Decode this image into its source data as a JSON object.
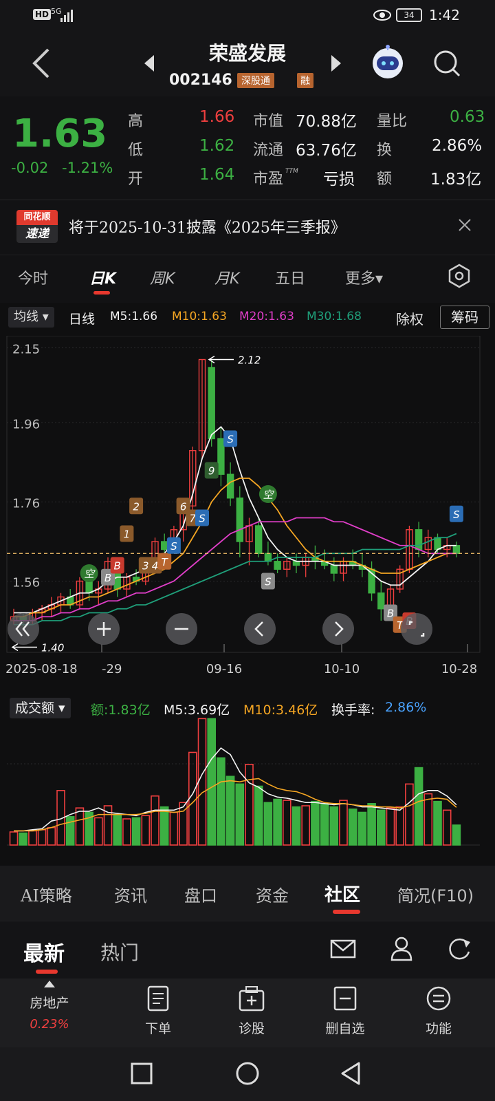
{
  "status": {
    "hd": "HD",
    "net": "5G",
    "battery": "34",
    "time": "1:42"
  },
  "header": {
    "name": "荣盛发展",
    "code": "002146",
    "tag1": "深股通",
    "tag2": "融"
  },
  "quote": {
    "price": "1.63",
    "change": "-0.02",
    "pct": "-1.21%",
    "high_label": "高",
    "high": "1.66",
    "low_label": "低",
    "low": "1.62",
    "open_label": "开",
    "open": "1.64",
    "mcap_label": "市值",
    "mcap": "70.88亿",
    "float_label": "流通",
    "float": "63.76亿",
    "pe_label": "市盈",
    "pe_sup": "TTM",
    "pe": "亏损",
    "vr_label": "量比",
    "vr": "0.63",
    "turn_label": "换",
    "turn": "2.86%",
    "amt_label": "额",
    "amt": "1.83亿"
  },
  "notice": {
    "badge_top": "同花顺",
    "badge_bottom": "速递",
    "text": "将于2025-10-31披露《2025年三季报》"
  },
  "ktabs": [
    "今时",
    "日K",
    "周K",
    "月K",
    "五日",
    "更多▾"
  ],
  "ma_legend": {
    "btn": "均线",
    "period": "日线",
    "m5": "M5:1.66",
    "m10": "M10:1.63",
    "m20": "M20:1.63",
    "m30": "M30:1.68",
    "exright": "除权",
    "chip": "筹码"
  },
  "chart_data": {
    "type": "candlestick",
    "yticks": [
      "2.15",
      "1.96",
      "1.76",
      "1.56"
    ],
    "ylim": [
      1.38,
      2.18
    ],
    "dates": [
      "2025-08-18",
      "-29",
      "09-16",
      "10-10",
      "10-28"
    ],
    "high_marker": "2.12",
    "low_marker": "1.40",
    "last_price": 1.63,
    "ohlc": [
      [
        1.46,
        1.49,
        1.45,
        1.47
      ],
      [
        1.47,
        1.48,
        1.44,
        1.46
      ],
      [
        1.46,
        1.49,
        1.45,
        1.48
      ],
      [
        1.48,
        1.5,
        1.46,
        1.49
      ],
      [
        1.49,
        1.52,
        1.47,
        1.5
      ],
      [
        1.5,
        1.53,
        1.48,
        1.52
      ],
      [
        1.52,
        1.54,
        1.49,
        1.5
      ],
      [
        1.5,
        1.57,
        1.49,
        1.56
      ],
      [
        1.56,
        1.58,
        1.51,
        1.53
      ],
      [
        1.53,
        1.56,
        1.5,
        1.54
      ],
      [
        1.54,
        1.62,
        1.53,
        1.61
      ],
      [
        1.6,
        1.62,
        1.52,
        1.54
      ],
      [
        1.54,
        1.58,
        1.52,
        1.57
      ],
      [
        1.57,
        1.59,
        1.55,
        1.56
      ],
      [
        1.56,
        1.6,
        1.55,
        1.59
      ],
      [
        1.59,
        1.67,
        1.58,
        1.66
      ],
      [
        1.66,
        1.68,
        1.62,
        1.64
      ],
      [
        1.64,
        1.7,
        1.63,
        1.69
      ],
      [
        1.69,
        1.76,
        1.66,
        1.75
      ],
      [
        1.75,
        1.9,
        1.74,
        1.89
      ],
      [
        1.89,
        2.12,
        1.87,
        2.12
      ],
      [
        2.1,
        2.12,
        1.9,
        1.92
      ],
      [
        1.92,
        1.95,
        1.8,
        1.83
      ],
      [
        1.83,
        1.86,
        1.75,
        1.77
      ],
      [
        1.77,
        1.8,
        1.62,
        1.66
      ],
      [
        1.66,
        1.72,
        1.6,
        1.7
      ],
      [
        1.7,
        1.72,
        1.62,
        1.63
      ],
      [
        1.63,
        1.66,
        1.6,
        1.61
      ],
      [
        1.61,
        1.63,
        1.58,
        1.59
      ],
      [
        1.59,
        1.62,
        1.57,
        1.61
      ],
      [
        1.61,
        1.63,
        1.58,
        1.6
      ],
      [
        1.6,
        1.63,
        1.57,
        1.62
      ],
      [
        1.62,
        1.65,
        1.59,
        1.61
      ],
      [
        1.61,
        1.64,
        1.59,
        1.6
      ],
      [
        1.6,
        1.62,
        1.56,
        1.58
      ],
      [
        1.58,
        1.62,
        1.56,
        1.61
      ],
      [
        1.61,
        1.64,
        1.59,
        1.6
      ],
      [
        1.6,
        1.63,
        1.57,
        1.59
      ],
      [
        1.59,
        1.61,
        1.51,
        1.53
      ],
      [
        1.53,
        1.56,
        1.46,
        1.49
      ],
      [
        1.49,
        1.55,
        1.46,
        1.54
      ],
      [
        1.54,
        1.6,
        1.53,
        1.59
      ],
      [
        1.59,
        1.7,
        1.58,
        1.69
      ],
      [
        1.69,
        1.71,
        1.62,
        1.64
      ],
      [
        1.64,
        1.69,
        1.62,
        1.67
      ],
      [
        1.67,
        1.68,
        1.63,
        1.64
      ],
      [
        1.64,
        1.67,
        1.62,
        1.65
      ],
      [
        1.65,
        1.66,
        1.62,
        1.63
      ]
    ],
    "ma5": [
      1.48,
      1.48,
      1.48,
      1.49,
      1.5,
      1.51,
      1.52,
      1.53,
      1.53,
      1.54,
      1.56,
      1.57,
      1.57,
      1.58,
      1.59,
      1.61,
      1.63,
      1.66,
      1.7,
      1.78,
      1.87,
      1.93,
      1.95,
      1.92,
      1.84,
      1.77,
      1.72,
      1.67,
      1.64,
      1.62,
      1.61,
      1.61,
      1.61,
      1.61,
      1.6,
      1.6,
      1.6,
      1.6,
      1.58,
      1.56,
      1.55,
      1.55,
      1.57,
      1.59,
      1.61,
      1.64,
      1.65,
      1.65
    ],
    "ma10": [
      1.47,
      1.47,
      1.48,
      1.48,
      1.49,
      1.5,
      1.5,
      1.51,
      1.52,
      1.52,
      1.53,
      1.54,
      1.55,
      1.56,
      1.57,
      1.58,
      1.59,
      1.61,
      1.63,
      1.67,
      1.71,
      1.76,
      1.79,
      1.81,
      1.82,
      1.82,
      1.8,
      1.77,
      1.74,
      1.7,
      1.67,
      1.64,
      1.62,
      1.61,
      1.61,
      1.61,
      1.61,
      1.6,
      1.59,
      1.58,
      1.58,
      1.58,
      1.59,
      1.6,
      1.61,
      1.62,
      1.63,
      1.63
    ],
    "ma20": [
      1.46,
      1.46,
      1.46,
      1.47,
      1.47,
      1.48,
      1.48,
      1.49,
      1.49,
      1.5,
      1.51,
      1.51,
      1.52,
      1.53,
      1.53,
      1.54,
      1.55,
      1.56,
      1.58,
      1.6,
      1.62,
      1.64,
      1.66,
      1.68,
      1.69,
      1.7,
      1.71,
      1.71,
      1.71,
      1.71,
      1.72,
      1.72,
      1.72,
      1.72,
      1.71,
      1.71,
      1.7,
      1.69,
      1.68,
      1.67,
      1.66,
      1.65,
      1.65,
      1.64,
      1.63,
      1.63,
      1.63,
      1.63
    ],
    "ma30": [
      1.45,
      1.45,
      1.45,
      1.46,
      1.46,
      1.46,
      1.47,
      1.47,
      1.48,
      1.48,
      1.48,
      1.49,
      1.49,
      1.5,
      1.5,
      1.51,
      1.52,
      1.53,
      1.54,
      1.55,
      1.56,
      1.57,
      1.58,
      1.59,
      1.6,
      1.61,
      1.61,
      1.61,
      1.62,
      1.62,
      1.62,
      1.62,
      1.62,
      1.63,
      1.63,
      1.63,
      1.63,
      1.64,
      1.64,
      1.64,
      1.64,
      1.64,
      1.65,
      1.65,
      1.66,
      1.67,
      1.67,
      1.68
    ]
  },
  "volume": {
    "btn": "成交额",
    "amt": "额:1.83亿",
    "m5": "M5:3.69亿",
    "m10": "M10:3.46亿",
    "turn_label": "换手率:",
    "turn": "2.86%",
    "values": [
      1.2,
      1.1,
      1.3,
      1.4,
      1.6,
      5.0,
      2.6,
      3.4,
      3.0,
      2.5,
      3.6,
      2.8,
      2.4,
      2.5,
      2.7,
      4.5,
      3.5,
      3.0,
      3.9,
      8.5,
      11.6,
      11.6,
      8.0,
      6.3,
      5.6,
      7.4,
      5.4,
      3.9,
      4.2,
      4.1,
      3.5,
      3.6,
      4.0,
      3.8,
      3.5,
      4.1,
      3.3,
      3.0,
      3.8,
      3.2,
      3.4,
      3.5,
      5.6,
      7.1,
      4.7,
      4.0,
      3.2,
      1.83
    ],
    "m5_line": [
      1.3,
      1.3,
      1.4,
      1.5,
      2.2,
      2.4,
      2.8,
      3.1,
      3.1,
      3.4,
      3.0,
      2.9,
      2.8,
      2.7,
      3.0,
      3.2,
      3.2,
      3.2,
      3.5,
      4.7,
      6.5,
      7.9,
      8.9,
      8.3,
      6.7,
      5.7,
      5.3,
      4.7,
      4.4,
      4.3,
      4.1,
      3.9,
      3.9,
      3.8,
      3.7,
      3.8,
      3.7,
      3.5,
      3.5,
      3.4,
      3.3,
      3.2,
      3.9,
      4.7,
      5.0,
      5.0,
      4.5,
      3.69
    ],
    "m10_line": [
      1.3,
      1.3,
      1.3,
      1.4,
      1.6,
      1.9,
      2.1,
      2.3,
      2.5,
      2.8,
      2.8,
      2.8,
      2.8,
      2.8,
      2.9,
      3.1,
      3.1,
      3.0,
      3.1,
      3.9,
      4.8,
      5.3,
      5.8,
      5.9,
      5.8,
      6.0,
      6.1,
      5.6,
      5.2,
      5.0,
      4.9,
      4.6,
      4.2,
      3.9,
      3.8,
      3.8,
      3.7,
      3.6,
      3.6,
      3.5,
      3.5,
      3.4,
      3.6,
      4.0,
      4.2,
      4.3,
      4.2,
      3.46
    ]
  },
  "subtabs": [
    "AI策略",
    "资讯",
    "盘口",
    "资金",
    "社区",
    "简况(F10)"
  ],
  "community": {
    "latest": "最新",
    "hot": "热门"
  },
  "bottombar": {
    "sector": "房地产",
    "sector_pct": "0.23%",
    "order": "下单",
    "diagnose": "诊股",
    "remove": "删自选",
    "func": "功能"
  }
}
